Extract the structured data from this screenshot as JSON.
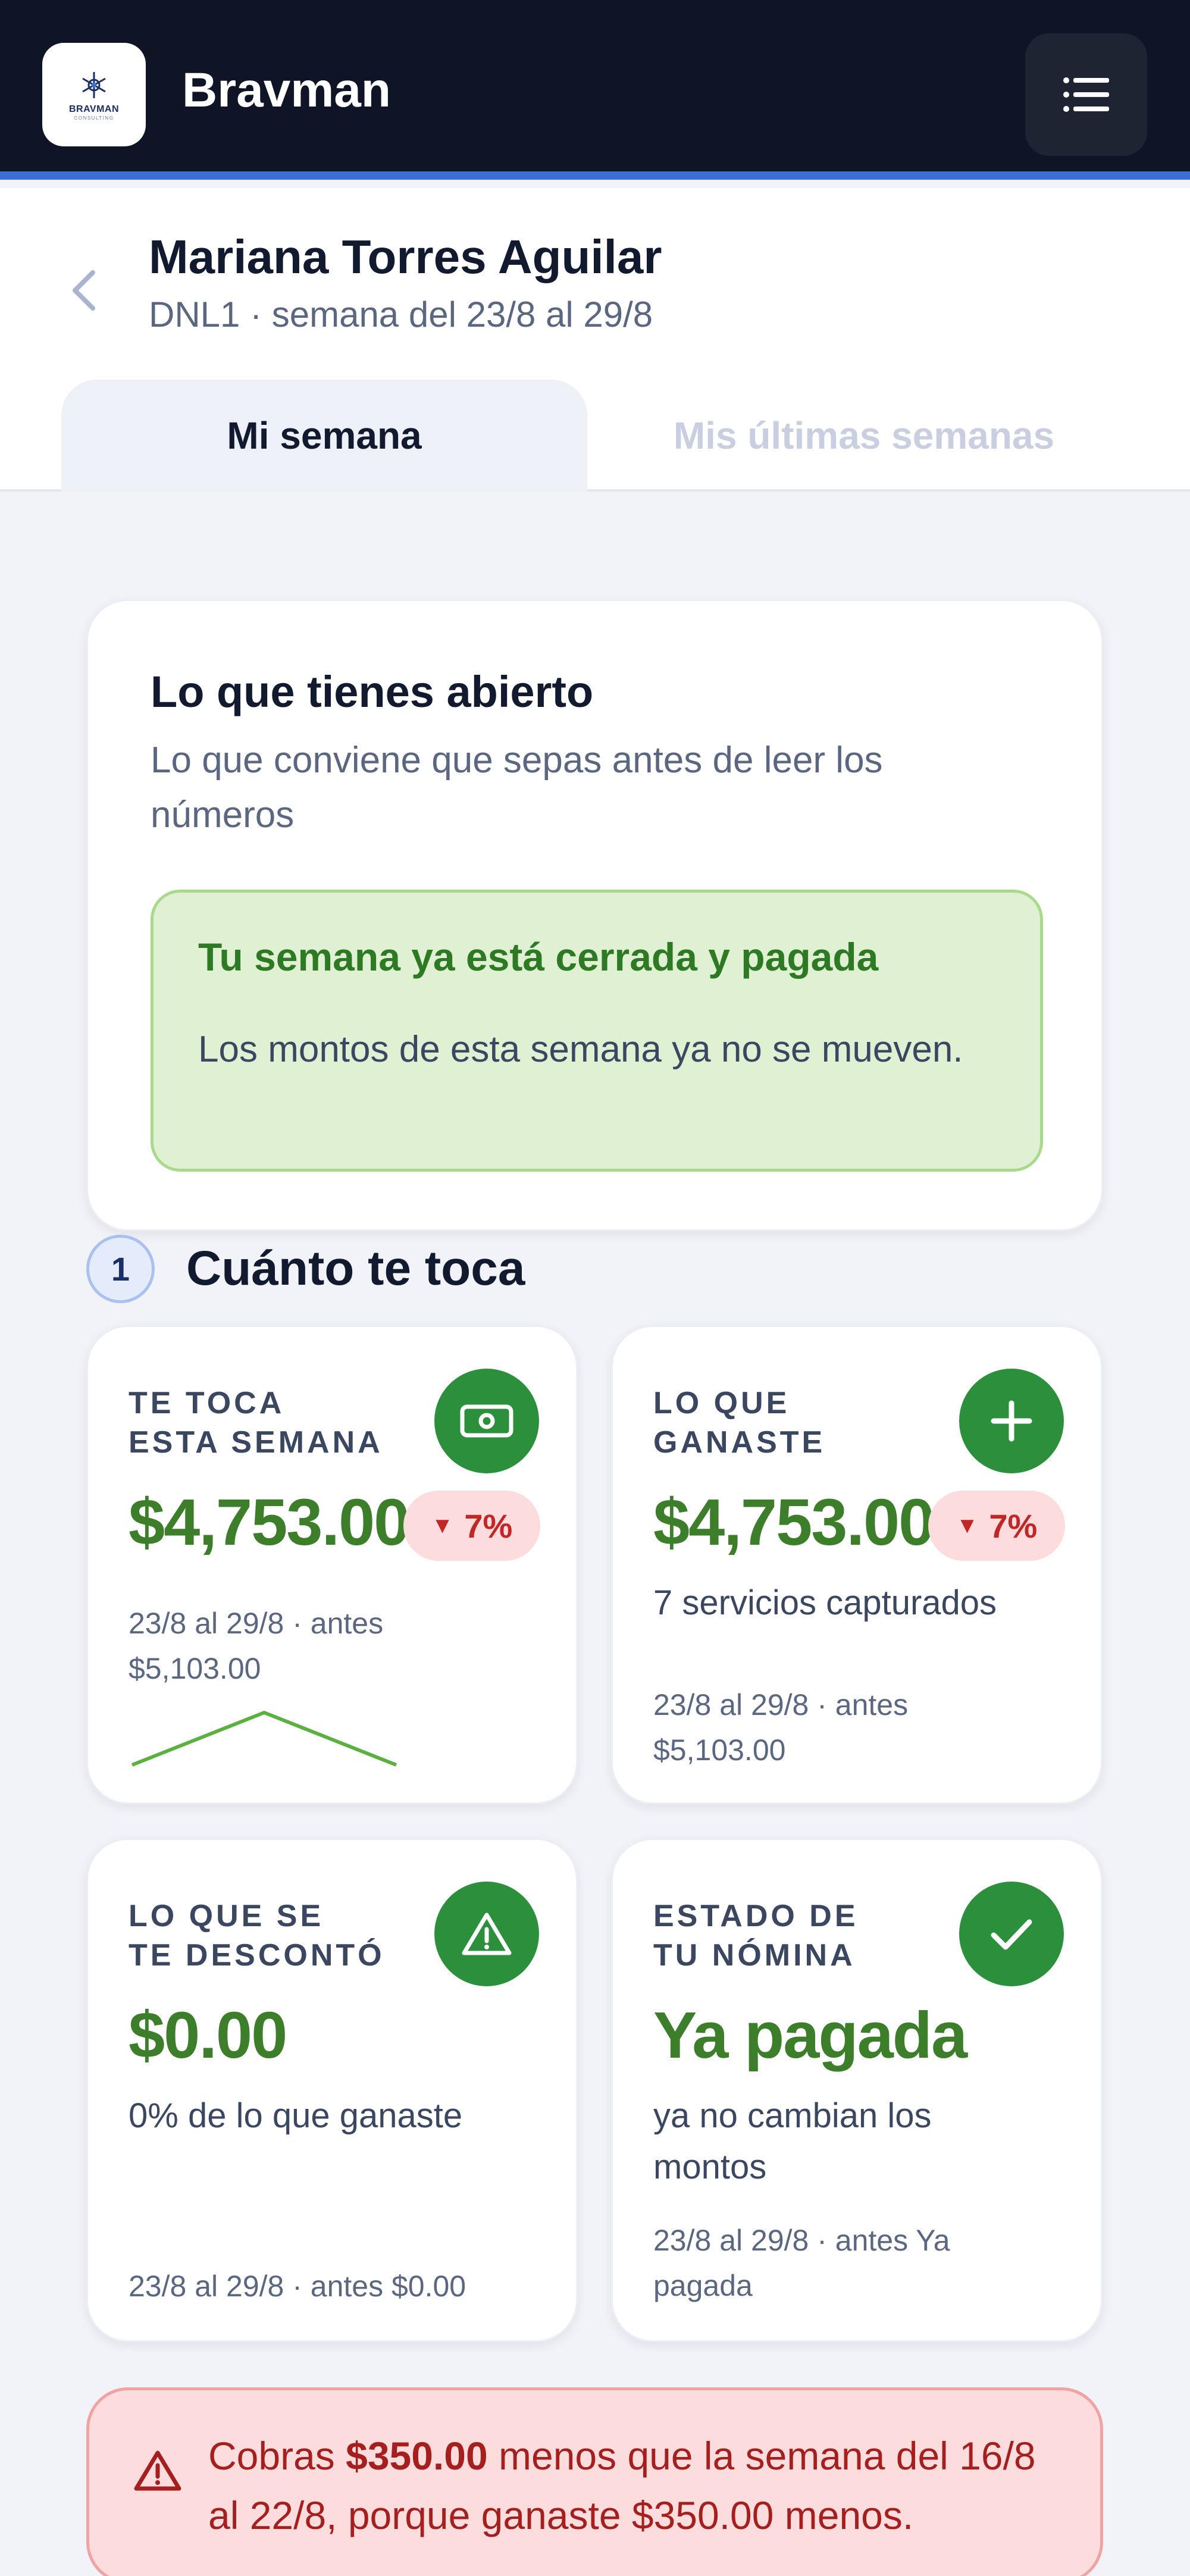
{
  "app": {
    "brand": "Bravman",
    "logo_text": "BRAVMAN",
    "logo_sub": "CONSULTING"
  },
  "colors": {
    "topbar": "#0f1526",
    "accent_blue": "#3b6fd4",
    "green": "#2b8f3c",
    "value_green": "#3c7e2a",
    "danger": "#c22727"
  },
  "header": {
    "name": "Mariana Torres Aguilar",
    "subtitle": "DNL1 · semana del 23/8 al 29/8",
    "tabs": [
      {
        "label": "Mi semana",
        "active": true
      },
      {
        "label": "Mis últimas semanas",
        "active": false
      }
    ]
  },
  "open_card": {
    "title": "Lo que tienes abierto",
    "description": "Lo que conviene que sepas antes de leer los números",
    "status_title": "Tu semana ya está cerrada y pagada",
    "status_desc": "Los montos de esta semana ya no se mueven."
  },
  "section": {
    "number": "1",
    "title": "Cuánto te toca"
  },
  "metrics": [
    {
      "label_line1": "TE TOCA",
      "label_line2": "ESTA SEMANA",
      "icon": "cash-icon",
      "value": "$4,753.00",
      "badge": "7%",
      "detail1": "23/8 al 29/8 · antes",
      "detail2": "$5,103.00",
      "sparkline": [
        0,
        1,
        0
      ]
    },
    {
      "label_line1": "LO QUE",
      "label_line2": "GANASTE",
      "icon": "plus-icon",
      "value": "$4,753.00",
      "badge": "7%",
      "info": "7 servicios capturados",
      "detail1": "23/8 al 29/8 · antes",
      "detail2": "$5,103.00"
    },
    {
      "label_line1": "LO QUE SE",
      "label_line2": "TE DESCONTÓ",
      "icon": "warning-icon",
      "value": "$0.00",
      "info": "0% de lo que ganaste",
      "detail1": "23/8 al 29/8 · antes $0.00"
    },
    {
      "label_line1": "ESTADO DE",
      "label_line2": "TU NÓMINA",
      "icon": "check-icon",
      "value": "Ya pagada",
      "info1": "ya no cambian los",
      "info2": "montos",
      "detail1": "23/8 al 29/8 · antes Ya",
      "detail2": "pagada"
    }
  ],
  "alert": {
    "prefix": "Cobras ",
    "amount": "$350.00",
    "suffix": " menos que la semana del 16/8 al 22/8, porque ganaste $350.00 menos."
  }
}
